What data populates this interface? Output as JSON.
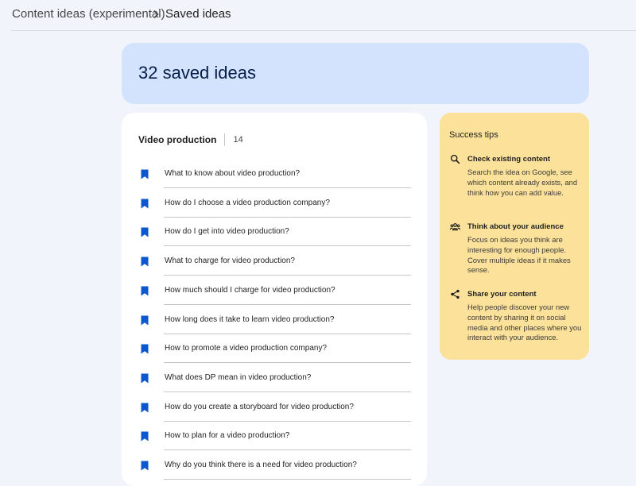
{
  "breadcrumb": {
    "root": "Content ideas (experimental)",
    "current": "Saved ideas"
  },
  "hero": {
    "title": "32 saved ideas"
  },
  "list": {
    "title": "Video production",
    "count": "14",
    "items": [
      "What to know about video production?",
      "How do I choose a video production company?",
      "How do I get into video production?",
      "What to charge for video production?",
      "How much should I charge for video production?",
      "How long does it take to learn video production?",
      "How to promote a video production company?",
      "What does DP mean in video production?",
      "How do you create a storyboard for video production?",
      "How to plan for a video production?",
      "Why do you think there is a need for video production?"
    ]
  },
  "tips": {
    "title": "Success tips",
    "items": [
      {
        "icon": "search-icon",
        "title": "Check existing content",
        "body": "Search the idea on Google, see which content already exists, and think how you can add value."
      },
      {
        "icon": "people-icon",
        "title": "Think about your audience",
        "body": "Focus on ideas you think are interesting for enough people. Cover multiple ideas if it makes sense."
      },
      {
        "icon": "share-icon",
        "title": "Share your content",
        "body": "Help people discover your new content by sharing it on social media and other places where you interact with your audience."
      }
    ]
  },
  "colors": {
    "page_bg": "#f1f4fb",
    "hero_bg": "#d3e3fd",
    "tips_bg": "#fbe19a",
    "bookmark": "#0b57d0"
  }
}
